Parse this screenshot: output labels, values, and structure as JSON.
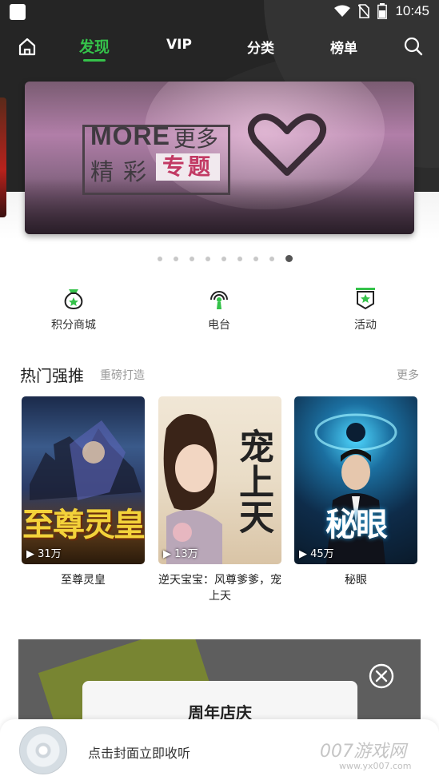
{
  "status_bar": {
    "time": "10:45"
  },
  "top_nav": {
    "tabs": [
      {
        "label": "发现",
        "active": true
      },
      {
        "label": "VIP",
        "active": false
      },
      {
        "label": "分类",
        "active": false
      },
      {
        "label": "榜单",
        "active": false
      }
    ]
  },
  "banner": {
    "line1_latin": "MORE",
    "line1_cn": "更多",
    "line2": "精彩",
    "line2_highlight": "专题",
    "page_count": 9,
    "active_page": 9
  },
  "shortcuts": [
    {
      "label": "积分商城",
      "icon": "points-mall-icon"
    },
    {
      "label": "电台",
      "icon": "radio-icon"
    },
    {
      "label": "活动",
      "icon": "activity-icon"
    }
  ],
  "hot_section": {
    "title": "热门强推",
    "subtitle": "重磅打造",
    "more": "更多",
    "books": [
      {
        "cover_title": "至尊灵皇",
        "plays": "31万",
        "name": "至尊灵皇"
      },
      {
        "cover_title": "宠上天",
        "plays": "13万",
        "name": "逆天宝宝：风尊爹爹，宠上天"
      },
      {
        "cover_title": "秘眼",
        "plays": "45万",
        "name": "秘眼"
      }
    ]
  },
  "promo": {
    "title": "周年店庆"
  },
  "player": {
    "prompt": "点击封面立即收听"
  },
  "watermark": {
    "brand": "007游戏网",
    "url": "www.yx007.com"
  },
  "colors": {
    "accent": "#35c24a",
    "header_bg": "#252525"
  }
}
